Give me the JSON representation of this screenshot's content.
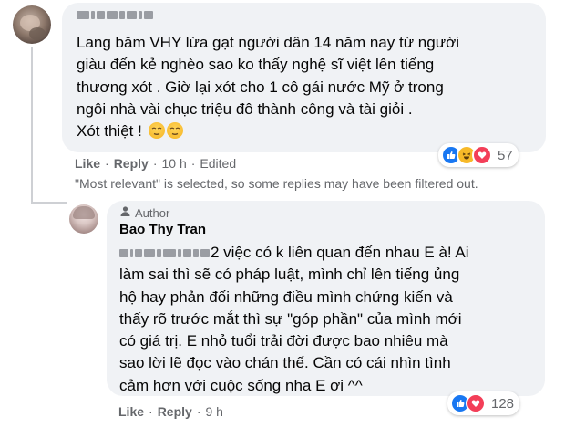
{
  "comments": [
    {
      "text": "Lang băm VHY lừa gạt người dân 14 năm nay từ người\ngiàu đến kẻ nghèo sao ko thấy nghệ sĩ việt lên tiếng\nthương xót . Giờ lại xót cho 1 cô gái nước Mỹ ở trong\nngôi nhà vài chục triệu đô thành công và tài giỏi .\nXót thiệt !",
      "like": "Like",
      "reply": "Reply",
      "time": "10 h",
      "edited": "Edited",
      "reaction_count": "57"
    },
    {
      "badge": "Author",
      "author": "Bao Thy Tran",
      "text": "2 việc có k liên quan đến nhau E à! Ai\nlàm sai thì sẽ có pháp luật, mình chỉ lên tiếng ủng\nhộ hay phản đối những điều mình chứng kiến và\nthấy rõ trước mắt thì sự \"góp phần\" của mình mới\ncó giá trị. E nhỏ tuổi trải đời được bao nhiêu mà\nsao lời lẽ đọc vào chán thế. Cần có cái nhìn tình\ncảm hơn với cuộc sống nha E ơi ^^",
      "like": "Like",
      "reply": "Reply",
      "time": "9 h",
      "reaction_count": "128"
    }
  ],
  "filter_note": "\"Most relevant\" is selected, so some replies may have been filtered out.",
  "colors": {
    "bubble": "#f0f2f5",
    "meta_text": "#65676b",
    "like_blue": "#1877f2",
    "love_red": "#f33e58",
    "haha_yellow": "#f7b928"
  },
  "icons": [
    "like-reaction-icon",
    "haha-reaction-icon",
    "love-reaction-icon",
    "author-badge-icon",
    "smirk-emoji-icon"
  ]
}
